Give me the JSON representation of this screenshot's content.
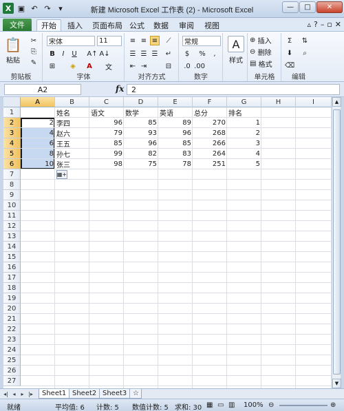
{
  "window": {
    "title": "新建 Microsoft Excel 工作表 (2) - Microsoft Excel"
  },
  "ribbon_tabs": [
    "文件",
    "开始",
    "插入",
    "页面布局",
    "公式",
    "数据",
    "审阅",
    "视图"
  ],
  "ribbon": {
    "font_name": "宋体",
    "font_size": "11",
    "number_format": "常规",
    "paste_label": "粘贴",
    "style_label": "样式",
    "insert_label": "插入",
    "delete_label": "删除",
    "format_label": "格式",
    "group_labels": [
      "剪贴板",
      "字体",
      "对齐方式",
      "数字",
      "单元格",
      "编辑"
    ]
  },
  "formula_bar": {
    "name_box": "A2",
    "fx": "fx",
    "value": "2"
  },
  "grid": {
    "columns": [
      "A",
      "B",
      "C",
      "D",
      "E",
      "F",
      "G",
      "H",
      "I"
    ],
    "rows": [
      "1",
      "2",
      "3",
      "4",
      "5",
      "6",
      "7",
      "8",
      "9",
      "10",
      "11",
      "12",
      "13",
      "14",
      "15",
      "16",
      "17",
      "18",
      "19",
      "20",
      "21",
      "22",
      "23",
      "24",
      "25",
      "26",
      "27"
    ],
    "header": [
      "",
      "姓名",
      "语文",
      "数学",
      "英语",
      "总分",
      "排名"
    ],
    "data": [
      [
        "2",
        "李四",
        "96",
        "85",
        "89",
        "270",
        "1"
      ],
      [
        "4",
        "赵六",
        "79",
        "93",
        "96",
        "268",
        "2"
      ],
      [
        "6",
        "王五",
        "85",
        "96",
        "85",
        "266",
        "3"
      ],
      [
        "8",
        "孙七",
        "99",
        "82",
        "83",
        "264",
        "4"
      ],
      [
        "10",
        "张三",
        "98",
        "75",
        "78",
        "251",
        "5"
      ]
    ]
  },
  "sheets": [
    "Sheet1",
    "Sheet2",
    "Sheet3"
  ],
  "status": {
    "ready": "就绪",
    "average": "平均值: 6",
    "count": "计数: 5",
    "numeric_count": "数值计数: 5",
    "sum": "求和: 30",
    "zoom": "100%"
  }
}
